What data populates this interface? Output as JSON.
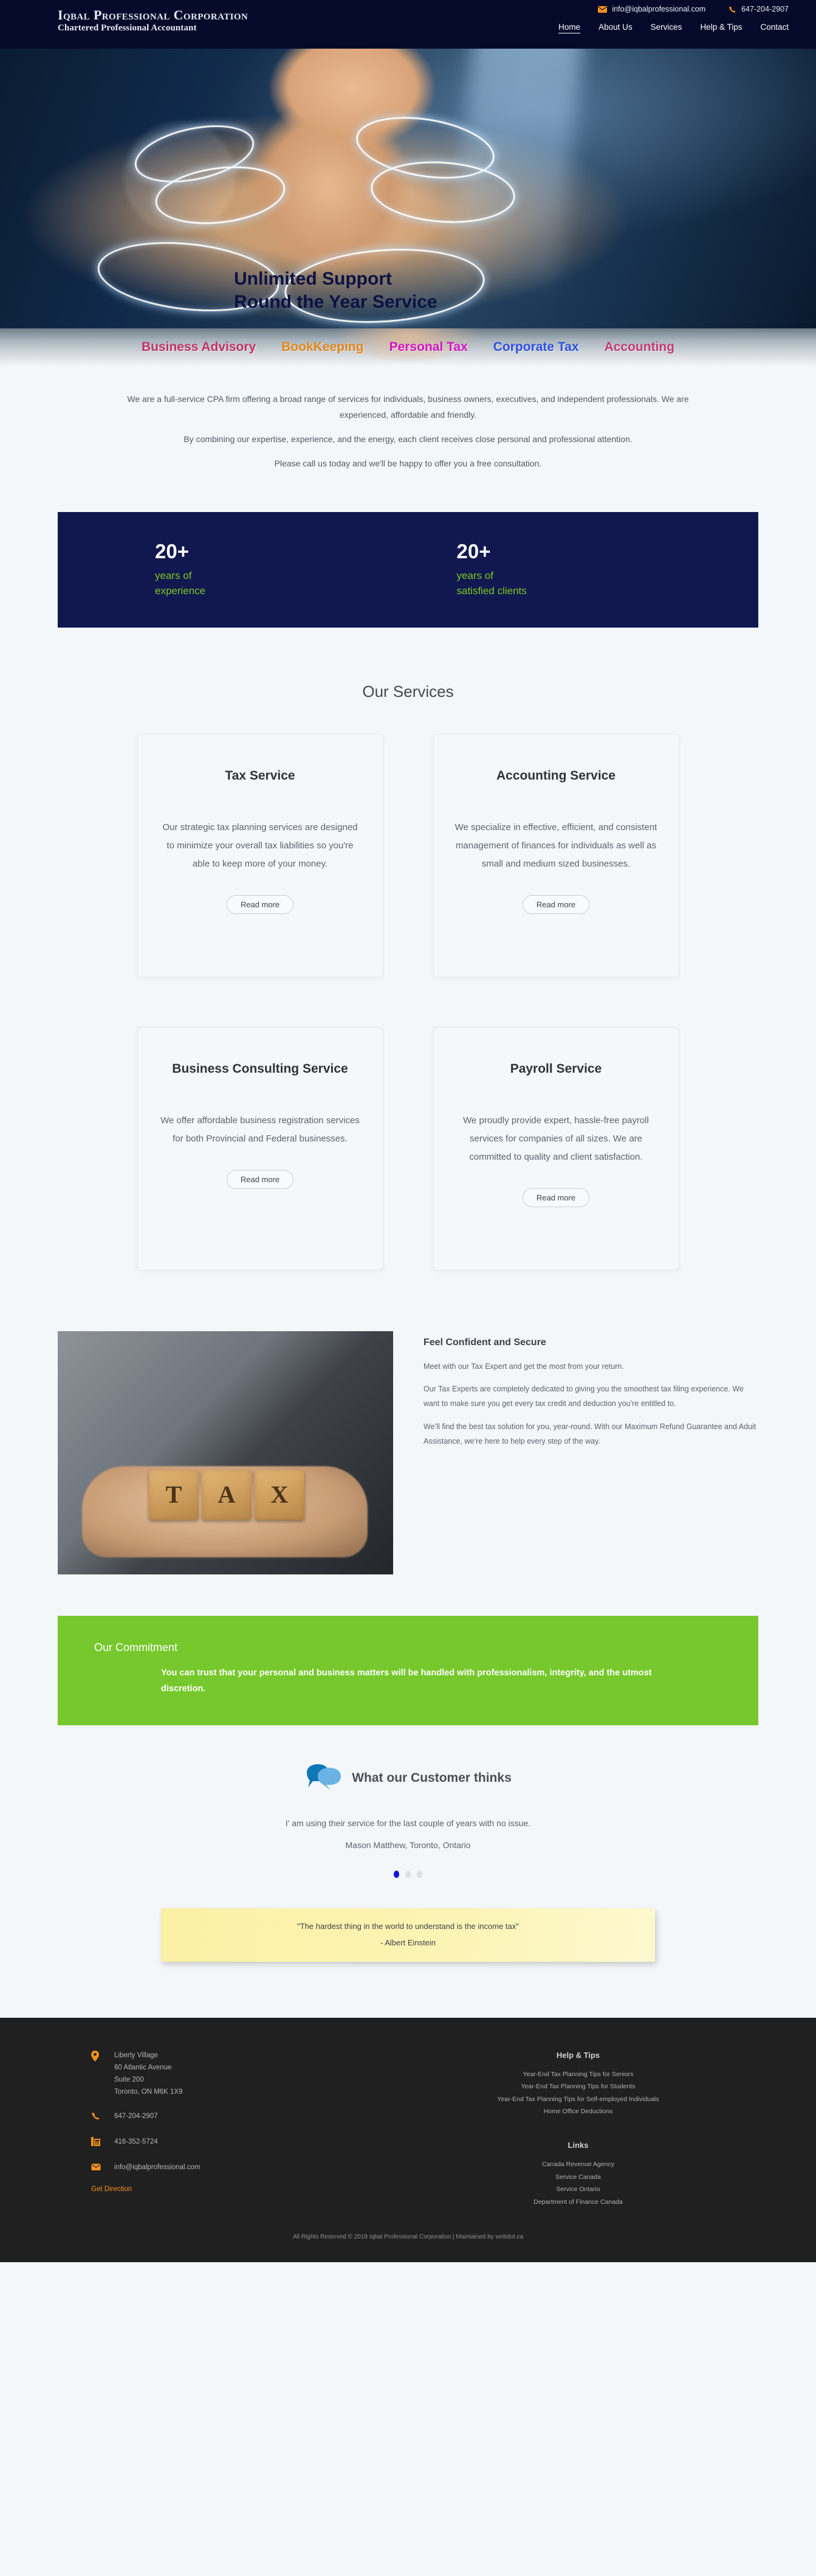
{
  "header": {
    "brand_title": "Iqbal Professional Corporation",
    "brand_subtitle": "Chartered Professional Accountant",
    "email": "info@iqbalprofessional.com",
    "phone": "647-204-2907",
    "nav": [
      {
        "label": "Home",
        "active": true
      },
      {
        "label": "About Us",
        "active": false
      },
      {
        "label": "Services",
        "active": false
      },
      {
        "label": "Help & Tips",
        "active": false
      },
      {
        "label": "Contact",
        "active": false
      }
    ]
  },
  "hero": {
    "line1": "Unlimited Support",
    "line2": "Round the Year Service"
  },
  "service_strip": [
    {
      "label": "Business Advisory",
      "color": "#c0326b"
    },
    {
      "label": "BookKeeping",
      "color": "#e0861c"
    },
    {
      "label": "Personal Tax",
      "color": "#d216c3"
    },
    {
      "label": "Corporate Tax",
      "color": "#2f4fe0"
    },
    {
      "label": "Accounting",
      "color": "#c53a7a"
    }
  ],
  "intro": {
    "p1": "We are a full-service CPA firm offering a broad range of services for individuals, business owners, executives, and independent professionals. We are experienced, affordable and friendly.",
    "p2": "By combining our expertise, experience, and the energy, each client receives close personal and professional attention.",
    "p3": "Please call us today and we'll be happy to offer you a free consultation."
  },
  "stats": [
    {
      "number": "20+",
      "label_line1": "years of",
      "label_line2": "experience"
    },
    {
      "number": "20+",
      "label_line1": "years of",
      "label_line2": "satisfied clients"
    }
  ],
  "services": {
    "heading": "Our Services",
    "read_more_label": "Read more",
    "cards": [
      {
        "title": "Tax Service",
        "body": "Our strategic tax planning services are designed to minimize your overall tax liabilities so you're able to keep more of your money."
      },
      {
        "title": "Accounting Service",
        "body": "We specialize in effective, efficient, and consistent management of finances for individuals as well as small and medium sized businesses."
      },
      {
        "title": "Business Consulting Service",
        "body": "We offer affordable business registration services for both Provincial and Federal businesses."
      },
      {
        "title": "Payroll Service",
        "body": "We proudly provide expert, hassle-free payroll services for companies of all sizes. We are committed to quality and client satisfaction."
      }
    ]
  },
  "confident": {
    "image_word": "TAX",
    "title": "Feel Confident and Secure",
    "p1": "Meet with our Tax Expert and get the most from your return.",
    "p2": "Our Tax Experts are completely dedicated to giving you the smoothest tax filing experience. We want to make sure you get every tax credit and deduction you’re entitled to.",
    "p3": "We’ll find the best tax solution for you, year-round. With our Maximum Refund Guarantee and Aduit Assistance, we’re here to help every step of the way."
  },
  "commitment": {
    "title": "Our Commitment",
    "body": "You can trust that your personal and business matters will be handled with professionalism, integrity, and the utmost discretion."
  },
  "testimonial": {
    "heading": "What our Customer thinks",
    "quote": "I' am using their service for the last couple of years with no issue.",
    "author": "Mason Matthew, Toronto, Ontario",
    "slides": 3,
    "active_slide": 0
  },
  "quote_box": {
    "line1": "\"The hardest thing in the world to understand is the income tax\"",
    "line2": "- Albert Einstein"
  },
  "footer": {
    "address": {
      "line1": "Liberty Village",
      "line2": "60 Atlantic Avenue",
      "line3": "Suite 200",
      "line4": "Toronto, ON M6K 1X9"
    },
    "phone": "647-204-2907",
    "fax": "416-352-5724",
    "email": "info@iqbalprofessional.com",
    "get_direction": "Get Direction",
    "help_tips": {
      "heading": "Help & Tips",
      "items": [
        "Year-End Tax Planning Tips for Seniors",
        "Year-End Tax Planning Tips for Students",
        "Year-End Tax Planning Tips for Self-employed Individuals",
        "Home Office Deductions"
      ]
    },
    "links": {
      "heading": "Links",
      "items": [
        "Canada Revenue Agency",
        "Service Canada",
        "Service Ontario",
        "Department of Finance Canada"
      ]
    },
    "copyright": "All Rights Reserved © 2019 Iqbal Professional Corporation  |  Maintained by webdot.ca"
  },
  "colors": {
    "navy": "#060a2a",
    "deep_navy": "#11184f",
    "orange": "#f5921e",
    "green": "#76c82c",
    "lime": "#7dc623",
    "page_bg": "#f3f7fa",
    "footer_bg": "#202020"
  }
}
